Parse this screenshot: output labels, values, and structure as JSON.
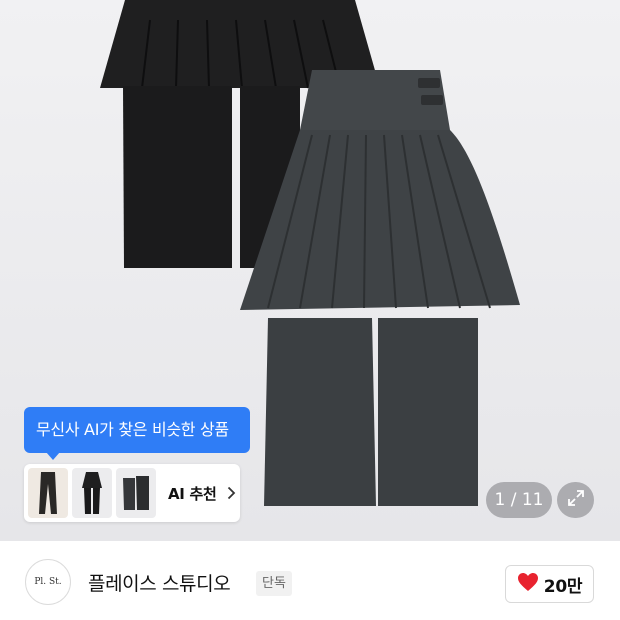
{
  "product_image": {
    "alt_icon": "pleated-skirt-pants-photo",
    "pager": {
      "current": 1,
      "total": 11,
      "label": "1 / 11"
    },
    "colors": {
      "front_garment": "#3d4043",
      "back_garment": "#1e1e1f",
      "background": "#ebebed"
    }
  },
  "ai_recommend": {
    "bubble_text": "무신사 AI가 찾은 비슷한 상품",
    "button_label": "AI 추천",
    "accent_color": "#2f7df6",
    "thumbnails": [
      "thumb-product-1",
      "thumb-product-2",
      "thumb-product-3"
    ]
  },
  "brand": {
    "logo_text": "Pl. St.",
    "name": "플레이스 스튜디오",
    "badge": "단독"
  },
  "like": {
    "count": "20만",
    "heart_color": "#e8232f"
  }
}
